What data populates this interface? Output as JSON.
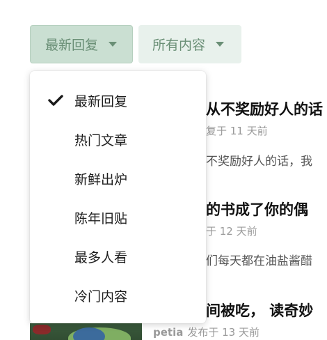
{
  "filters": {
    "sort_label": "最新回复",
    "scope_label": "所有内容"
  },
  "menu": {
    "items": [
      {
        "label": "最新回复",
        "selected": true
      },
      {
        "label": "热门文章",
        "selected": false
      },
      {
        "label": "新鲜出炉",
        "selected": false
      },
      {
        "label": "陈年旧贴",
        "selected": false
      },
      {
        "label": "最多人看",
        "selected": false
      },
      {
        "label": "冷门内容",
        "selected": false
      }
    ]
  },
  "feed": {
    "posts": [
      {
        "title": "从不奖励好人的话",
        "meta": "复于 11 天前",
        "excerpt": "不奖励好人的话，我"
      },
      {
        "title": "的书成了你的偶",
        "meta": "于 12 天前",
        "excerpt": "们每天都在油盐酱醋"
      },
      {
        "title": "间被吃， 读奇妙",
        "author": "petia",
        "meta": "发布于 13 天前"
      }
    ]
  },
  "colors": {
    "accent": "#6a8f76",
    "button_active_bg": "#cadfd2",
    "button_bg": "#e8f1ec"
  }
}
